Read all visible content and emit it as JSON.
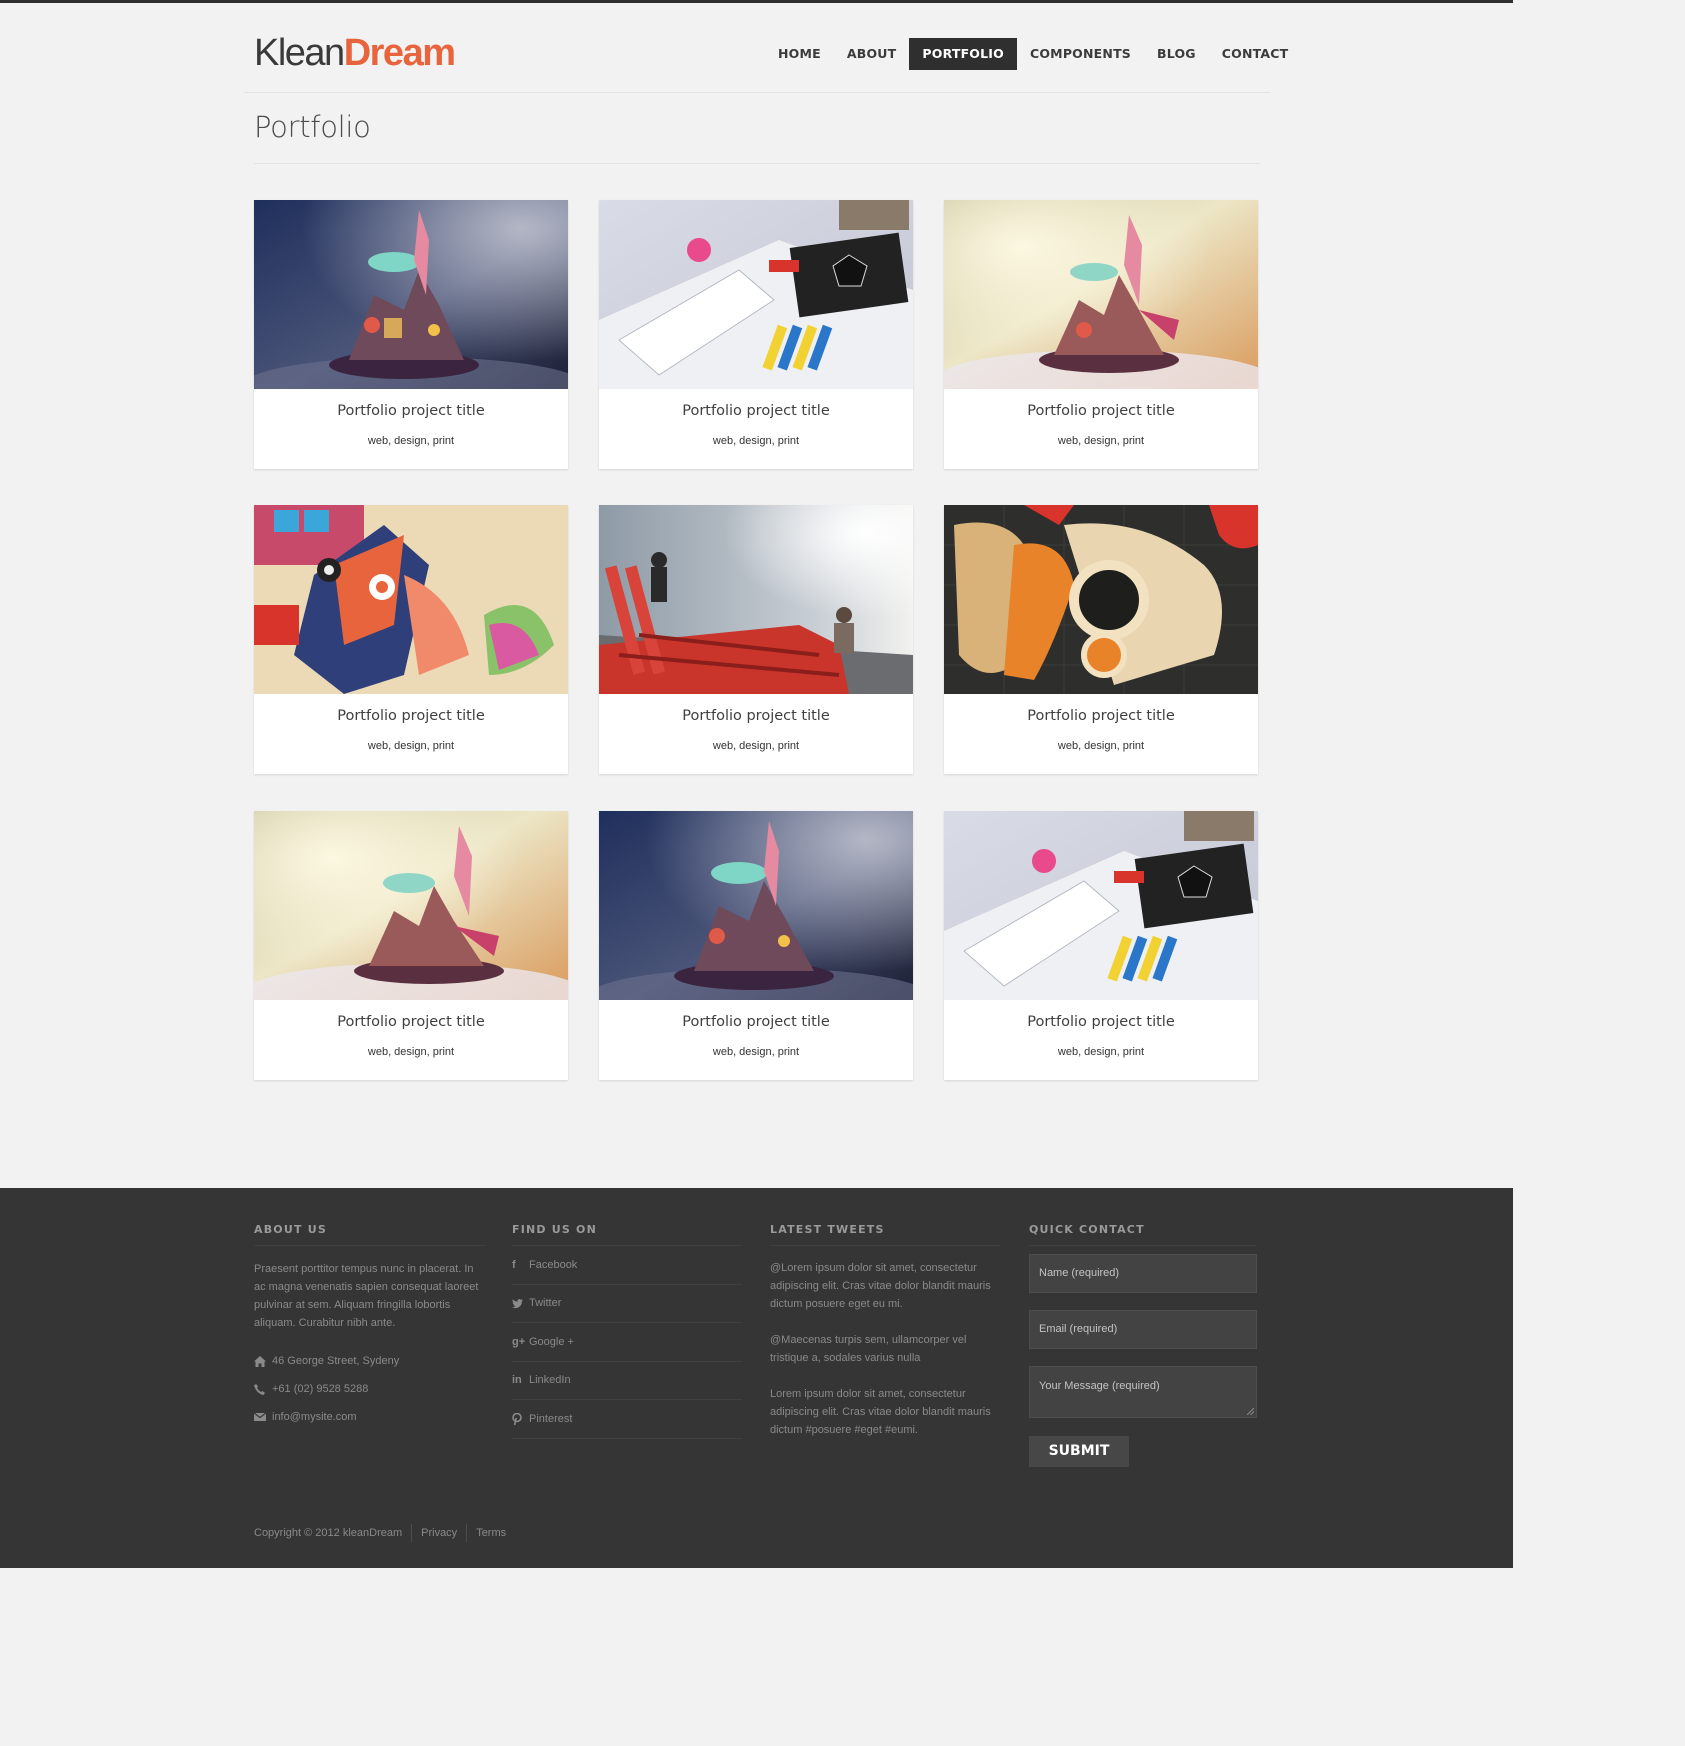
{
  "brand": {
    "part1": "Klean",
    "part2": "Dream",
    "accent_color": "#e8643c"
  },
  "nav": {
    "items": [
      {
        "label": "HOME",
        "active": false
      },
      {
        "label": "ABOUT",
        "active": false
      },
      {
        "label": "PORTFOLIO",
        "active": true
      },
      {
        "label": "COMPONENTS",
        "active": false
      },
      {
        "label": "BLOG",
        "active": false
      },
      {
        "label": "CONTACT",
        "active": false
      }
    ]
  },
  "page": {
    "title": "Portfolio"
  },
  "portfolio": {
    "items": [
      {
        "title": "Portfolio project title",
        "tags": "web, design, print",
        "image": "floating-island-night"
      },
      {
        "title": "Portfolio project title",
        "tags": "web, design, print",
        "image": "art-desk-supplies"
      },
      {
        "title": "Portfolio project title",
        "tags": "web, design, print",
        "image": "floating-island-warm"
      },
      {
        "title": "Portfolio project title",
        "tags": "web, design, print",
        "image": "papercraft-bird"
      },
      {
        "title": "Portfolio project title",
        "tags": "web, design, print",
        "image": "red-structure-street"
      },
      {
        "title": "Portfolio project title",
        "tags": "web, design, print",
        "image": "cut-paper-shapes"
      },
      {
        "title": "Portfolio project title",
        "tags": "web, design, print",
        "image": "floating-island-warm"
      },
      {
        "title": "Portfolio project title",
        "tags": "web, design, print",
        "image": "floating-island-night"
      },
      {
        "title": "Portfolio project title",
        "tags": "web, design, print",
        "image": "art-desk-supplies"
      }
    ]
  },
  "footer": {
    "about": {
      "heading": "ABOUT US",
      "text": "Praesent porttitor tempus nunc in placerat. In ac magna venenatis sapien consequat laoreet pulvinar at sem. Aliquam fringilla lobortis aliquam. Curabitur nibh ante.",
      "address": {
        "icon": "home-icon",
        "text": "46 George Street, Sydeny"
      },
      "phone": {
        "icon": "phone-icon",
        "text": "+61 (02) 9528 5288"
      },
      "email": {
        "icon": "mail-icon",
        "text": "info@mysite.com"
      }
    },
    "social": {
      "heading": "FIND US ON",
      "items": [
        {
          "label": "Facebook",
          "icon": "facebook-icon",
          "glyph": "f"
        },
        {
          "label": "Twitter",
          "icon": "twitter-icon",
          "glyph": ""
        },
        {
          "label": "Google +",
          "icon": "google-plus-icon",
          "glyph": "g+"
        },
        {
          "label": "LinkedIn",
          "icon": "linkedin-icon",
          "glyph": "in"
        },
        {
          "label": "Pinterest",
          "icon": "pinterest-icon",
          "glyph": ""
        }
      ]
    },
    "tweets": {
      "heading": "LATEST TWEETS",
      "items": [
        "@Lorem ipsum dolor sit amet, consectetur adipiscing elit. Cras vitae dolor blandit mauris dictum posuere eget eu mi.",
        "@Maecenas turpis sem, ullamcorper vel tristique a, sodales varius nulla",
        "Lorem ipsum dolor sit amet, consectetur adipiscing elit. Cras vitae dolor blandit mauris dictum #posuere #eget #eumi."
      ]
    },
    "contact": {
      "heading": "QUICK CONTACT",
      "name_placeholder": "Name (required)",
      "email_placeholder": "Email (required)",
      "message_placeholder": "Your Message (required)",
      "submit_label": "SUBMIT"
    },
    "bottom": {
      "copyright": "Copyright © 2012 kleanDream",
      "privacy": "Privacy",
      "terms": "Terms"
    }
  }
}
